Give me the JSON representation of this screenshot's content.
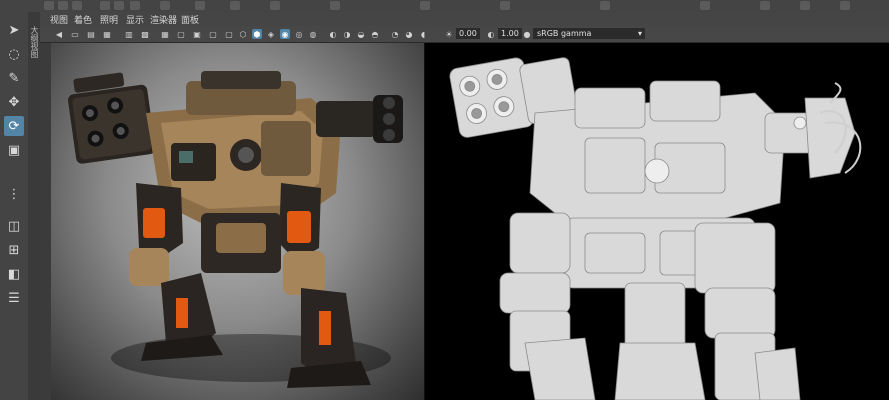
{
  "menu": {
    "view": "视图",
    "shading": "着色",
    "lighting": "照明",
    "show": "显示",
    "renderer": "渲染器",
    "panels": "面板"
  },
  "side_tab": {
    "label": "大纲视图"
  },
  "panel_toolbar": {
    "exposure_value": "0.00",
    "gamma_value": "1.00",
    "color_space": "sRGB gamma"
  },
  "icons": [
    "select-tool-icon",
    "lasso-tool-icon",
    "paint-select-icon",
    "move-tool-icon",
    "rotate-tool-icon",
    "scale-tool-icon",
    "layout-single-icon",
    "layout-four-icon",
    "layout-two-icon",
    "outliner-icon",
    "exposure-icon",
    "gamma-icon",
    "dropdown-caret-icon"
  ],
  "colors": {
    "accent": "#5285a6",
    "ui_bg": "#3d3d3d",
    "wire_bg": "#000000",
    "mech_orange": "#e25a12",
    "mech_tan": "#a7855a"
  }
}
